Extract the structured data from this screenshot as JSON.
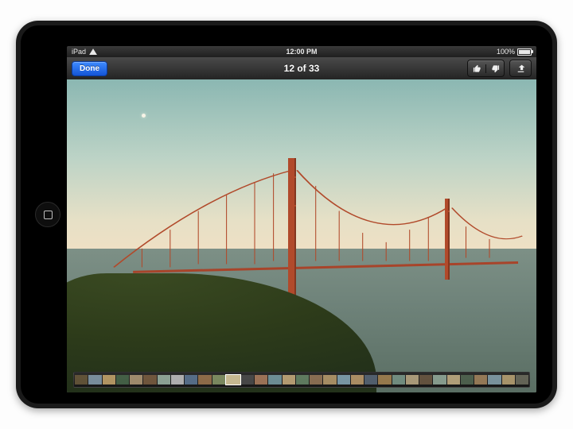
{
  "statusbar": {
    "carrier": "iPad",
    "time": "12:00 PM",
    "battery_pct": "100%"
  },
  "navbar": {
    "done_label": "Done",
    "title": "12 of 33"
  },
  "thumbs": {
    "count": 33,
    "selected_index": 11
  },
  "thumb_colors": [
    "#6b5a3c",
    "#88a0b0",
    "#caa96e",
    "#4a6a4c",
    "#b59d7a",
    "#7d5f42",
    "#9fb7a8",
    "#c8c8c8",
    "#5f7a99",
    "#a07850",
    "#8a9a6a",
    "#c5b890",
    "#4d4d4d",
    "#b08060",
    "#7aa0a8",
    "#ccb080",
    "#6a8a6a",
    "#9a7a5a",
    "#bda070",
    "#88aabb",
    "#c2a070",
    "#5a6a7a",
    "#aa8855",
    "#7f9f8f",
    "#bfae88",
    "#6f5a44",
    "#98b0a0",
    "#c9b488",
    "#556a55",
    "#a88860",
    "#8aa6b2",
    "#c0a878",
    "#707060"
  ]
}
